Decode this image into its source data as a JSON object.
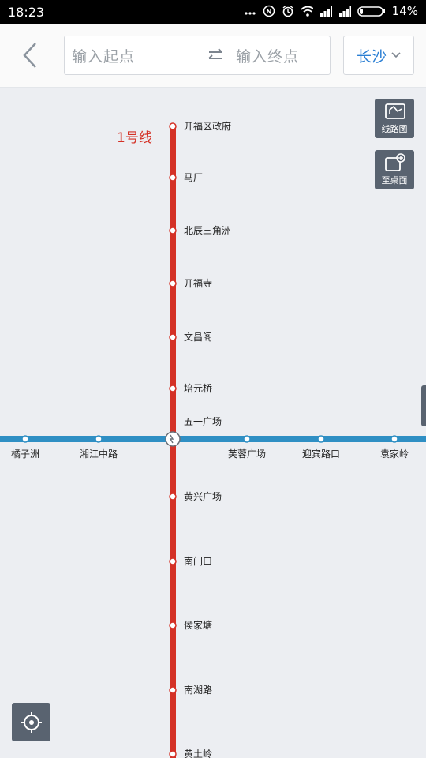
{
  "status_bar": {
    "time": "18:23",
    "battery": "14%",
    "icons": [
      "more-dots-icon",
      "nfc-icon",
      "alarm-icon",
      "wifi-icon",
      "signal-icon",
      "signal-icon",
      "battery-icon"
    ]
  },
  "header": {
    "start_placeholder": "输入起点",
    "end_placeholder": "输入终点",
    "city": "长沙"
  },
  "tools": {
    "route_map": "线路图",
    "to_desktop": "至桌面"
  },
  "map": {
    "line1": {
      "name": "1号线",
      "color": "#d43126",
      "stations": [
        "开福区政府",
        "马厂",
        "北辰三角洲",
        "开福寺",
        "文昌阁",
        "培元桥",
        "五一广场",
        "黄兴广场",
        "南门口",
        "侯家塘",
        "南湖路",
        "黄土岭"
      ]
    },
    "line2": {
      "color": "#2f8fc4",
      "stations": [
        "橘子洲",
        "湘江中路",
        "芙蓉广场",
        "迎宾路口",
        "袁家岭"
      ]
    },
    "transfer_station": "五一广场"
  }
}
